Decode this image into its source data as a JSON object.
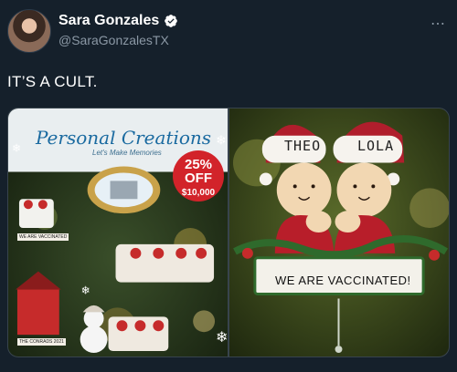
{
  "tweet": {
    "display_name": "Sara Gonzales",
    "handle": "@SaraGonzalesTX",
    "more_icon": "⋯",
    "text": "IT’S A CULT."
  },
  "media": {
    "left_image": {
      "brand": "Personal Creations",
      "tagline": "Let's Make Memories",
      "promo_pct": "25% OFF",
      "promo_amount": "$10,000",
      "ornament_label_1": "WE ARE VACCINATED",
      "ornament_label_2": "THE CONRADS 2021"
    },
    "right_image": {
      "name_left": "THEO",
      "name_right": "LOLA",
      "banner": "WE ARE VACCINATED!"
    }
  },
  "colors": {
    "background": "#15202b",
    "secondary_text": "#8b98a5",
    "verified": "#1d9bf0"
  }
}
